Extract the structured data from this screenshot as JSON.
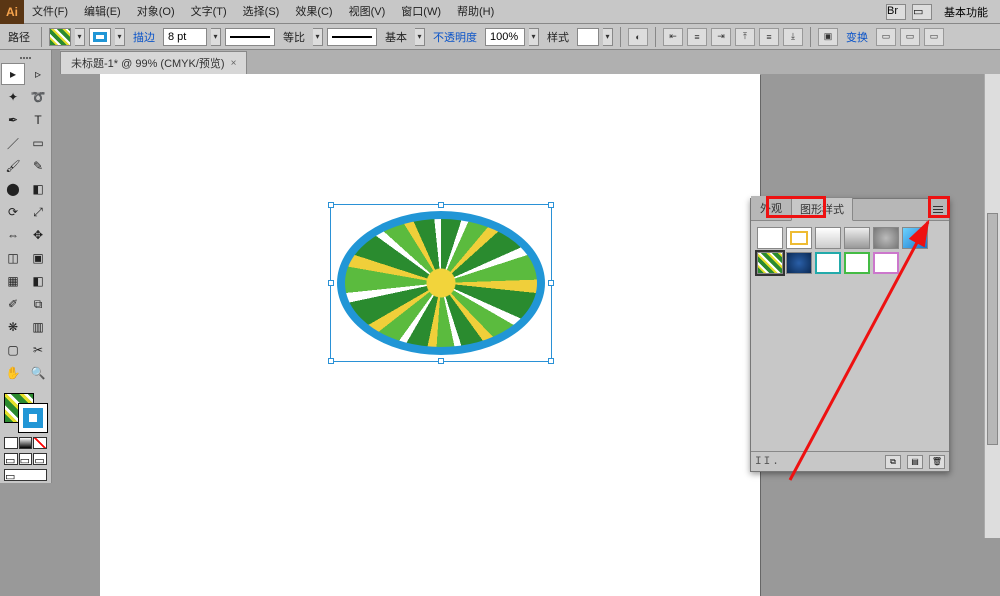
{
  "app": {
    "name": "Ai"
  },
  "menu": {
    "file": "文件(F)",
    "edit": "编辑(E)",
    "object": "对象(O)",
    "type": "文字(T)",
    "select": "选择(S)",
    "effect": "效果(C)",
    "view": "视图(V)",
    "window": "窗口(W)",
    "help": "帮助(H)"
  },
  "topright": {
    "basic_features": "基本功能"
  },
  "control": {
    "path_label": "路径",
    "stroke_label": "描边",
    "stroke_value": "8 pt",
    "dash_label": "等比",
    "profile_label": "基本",
    "opacity_label": "不透明度",
    "opacity_value": "100%",
    "style_label": "样式",
    "transform_link": "变换"
  },
  "document": {
    "tab_title": "未标题-1* @ 99% (CMYK/预览)",
    "tab_close": "×"
  },
  "panel": {
    "tab_appearance": "外观",
    "tab_graphic_styles": "图形样式"
  },
  "panel_footer": {
    "icons": "II."
  }
}
